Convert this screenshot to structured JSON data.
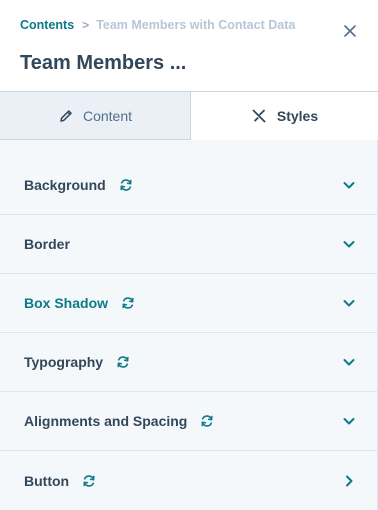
{
  "breadcrumb": {
    "parent": "Contents",
    "separator": ">",
    "current": "Team Members with Contact Data"
  },
  "header": {
    "title": "Team Members ..."
  },
  "tabs": [
    {
      "label": "Content",
      "icon": "pencil-icon",
      "active": false
    },
    {
      "label": "Styles",
      "icon": "brush-ruler-icon",
      "active": true
    }
  ],
  "sections": [
    {
      "label": "Background",
      "has_reset": true,
      "highlight": false,
      "chevron": "down"
    },
    {
      "label": "Border",
      "has_reset": false,
      "highlight": false,
      "chevron": "down"
    },
    {
      "label": "Box Shadow",
      "has_reset": true,
      "highlight": true,
      "chevron": "down"
    },
    {
      "label": "Typography",
      "has_reset": true,
      "highlight": false,
      "chevron": "down"
    },
    {
      "label": "Alignments and Spacing",
      "has_reset": true,
      "highlight": false,
      "chevron": "down"
    },
    {
      "label": "Button",
      "has_reset": true,
      "highlight": false,
      "chevron": "right"
    }
  ],
  "colors": {
    "accent": "#0b7a89",
    "text": "#33475b",
    "muted": "#b8c6d6",
    "background": "#f5f8fa"
  }
}
